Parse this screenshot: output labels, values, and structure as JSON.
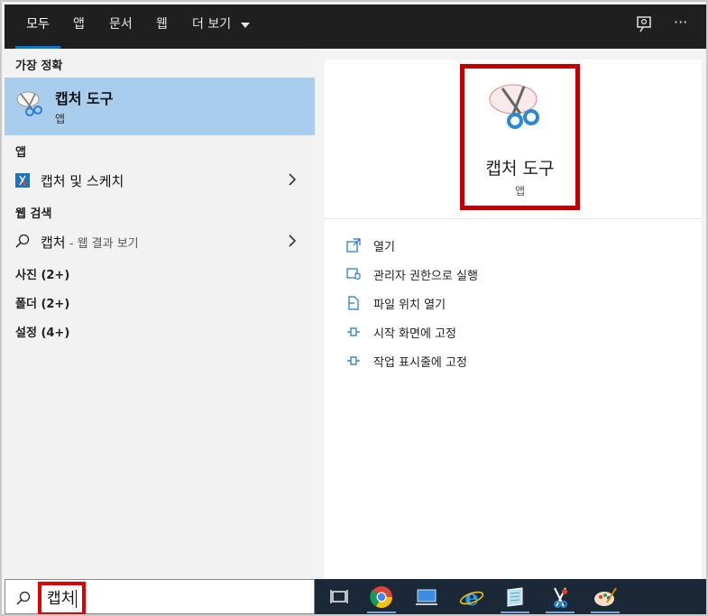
{
  "topbar": {
    "tabs": [
      {
        "label": "모두",
        "active": true
      },
      {
        "label": "앱"
      },
      {
        "label": "문서"
      },
      {
        "label": "웹"
      },
      {
        "label": "더 보기"
      }
    ],
    "icons": [
      "feedback-icon",
      "more-icon"
    ],
    "more_label": "···"
  },
  "left": {
    "best_match_header": "가장 정확",
    "best_match": {
      "title": "캡처 도구",
      "subtitle": "앱",
      "icon": "snipping-tool-icon"
    },
    "apps_header": "앱",
    "apps": [
      {
        "label": "캡처 및 스케치",
        "icon": "snip-sketch-icon"
      }
    ],
    "web_header": "웹 검색",
    "web": {
      "query": "캡처",
      "suffix": " - 웹 결과 보기"
    },
    "photos": "사진 (2+)",
    "folders": "폴더 (2+)",
    "settings": "설정 (4+)"
  },
  "right": {
    "title": "캡처 도구",
    "subtitle": "앱",
    "actions": [
      {
        "label": "열기",
        "icon": "open-icon"
      },
      {
        "label": "관리자 권한으로 실행",
        "icon": "admin-shield-icon"
      },
      {
        "label": "파일 위치 열기",
        "icon": "file-location-icon"
      },
      {
        "label": "시작 화면에 고정",
        "icon": "pin-icon"
      },
      {
        "label": "작업 표시줄에 고정",
        "icon": "pin-icon"
      }
    ]
  },
  "search": {
    "value": "캡처"
  },
  "colors": {
    "accent": "#0078d7",
    "highlight": "#a9cdec",
    "outline": "#c00000",
    "topbar": "#1f1f1f",
    "taskbar": "#1b2838"
  }
}
